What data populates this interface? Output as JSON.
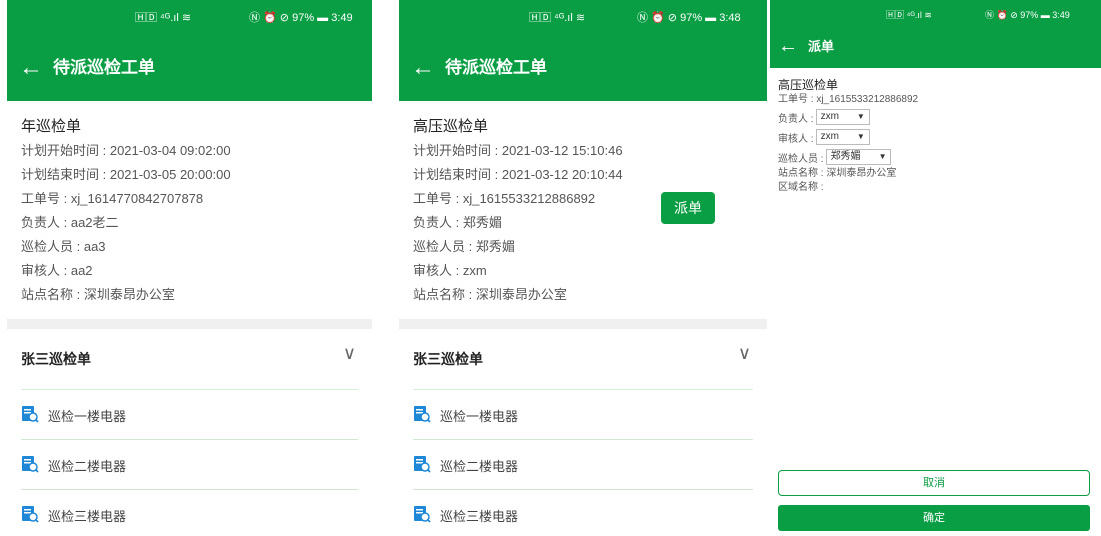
{
  "colors": {
    "accent": "#0a9e44"
  },
  "screen1": {
    "status": {
      "left": "🄷🄳 ⁴ᴳ.ıl ≋",
      "right": "Ⓝ ⏰ ⊘ 97% ▬ 3:49"
    },
    "title": "待派巡检工单",
    "order": {
      "name": "年巡检单",
      "rows": [
        "计划开始时间 : 2021-03-04 09:02:00",
        "计划结束时间 : 2021-03-05 20:00:00",
        "工单号 : xj_1614770842707878",
        "负责人 : aa2老二",
        "巡检人员 : aa3",
        "审核人 : aa2",
        "站点名称 : 深圳泰昂办公室"
      ]
    },
    "group_title": "张三巡检单",
    "items": [
      "巡检一楼电器",
      "巡检二楼电器",
      "巡检三楼电器"
    ]
  },
  "screen2": {
    "status": {
      "left": "🄷🄳 ⁴ᴳ.ıl ≋",
      "right": "Ⓝ ⏰ ⊘ 97% ▬ 3:48"
    },
    "title": "待派巡检工单",
    "order": {
      "name": "高压巡检单",
      "rows": [
        "计划开始时间 : 2021-03-12 15:10:46",
        "计划结束时间 : 2021-03-12 20:10:44",
        "工单号 : xj_1615533212886892",
        "负责人 : 郑秀媚",
        "巡检人员 : 郑秀媚",
        "审核人 : zxm",
        "站点名称 : 深圳泰昂办公室"
      ]
    },
    "dispatch_label": "派单",
    "group_title": "张三巡检单",
    "items": [
      "巡检一楼电器",
      "巡检二楼电器",
      "巡检三楼电器"
    ]
  },
  "screen3": {
    "status": {
      "left": "🄷🄳 ⁴ᴳ.ıl ≋",
      "right": "Ⓝ ⏰ ⊘ 97% ▬ 3:49"
    },
    "title": "派单",
    "order_name": "高压巡检单",
    "order_no": "工单号 : xj_1615533212886892",
    "fields": {
      "owner_label": "负责人 :",
      "owner_value": "zxm",
      "reviewer_label": "审核人 :",
      "reviewer_value": "zxm",
      "inspector_label": "巡检人员 :",
      "inspector_value": "郑秀媚",
      "station": "站点名称 : 深圳泰昂办公室",
      "area": "区域名称 :"
    },
    "cancel_label": "取消",
    "confirm_label": "确定"
  }
}
